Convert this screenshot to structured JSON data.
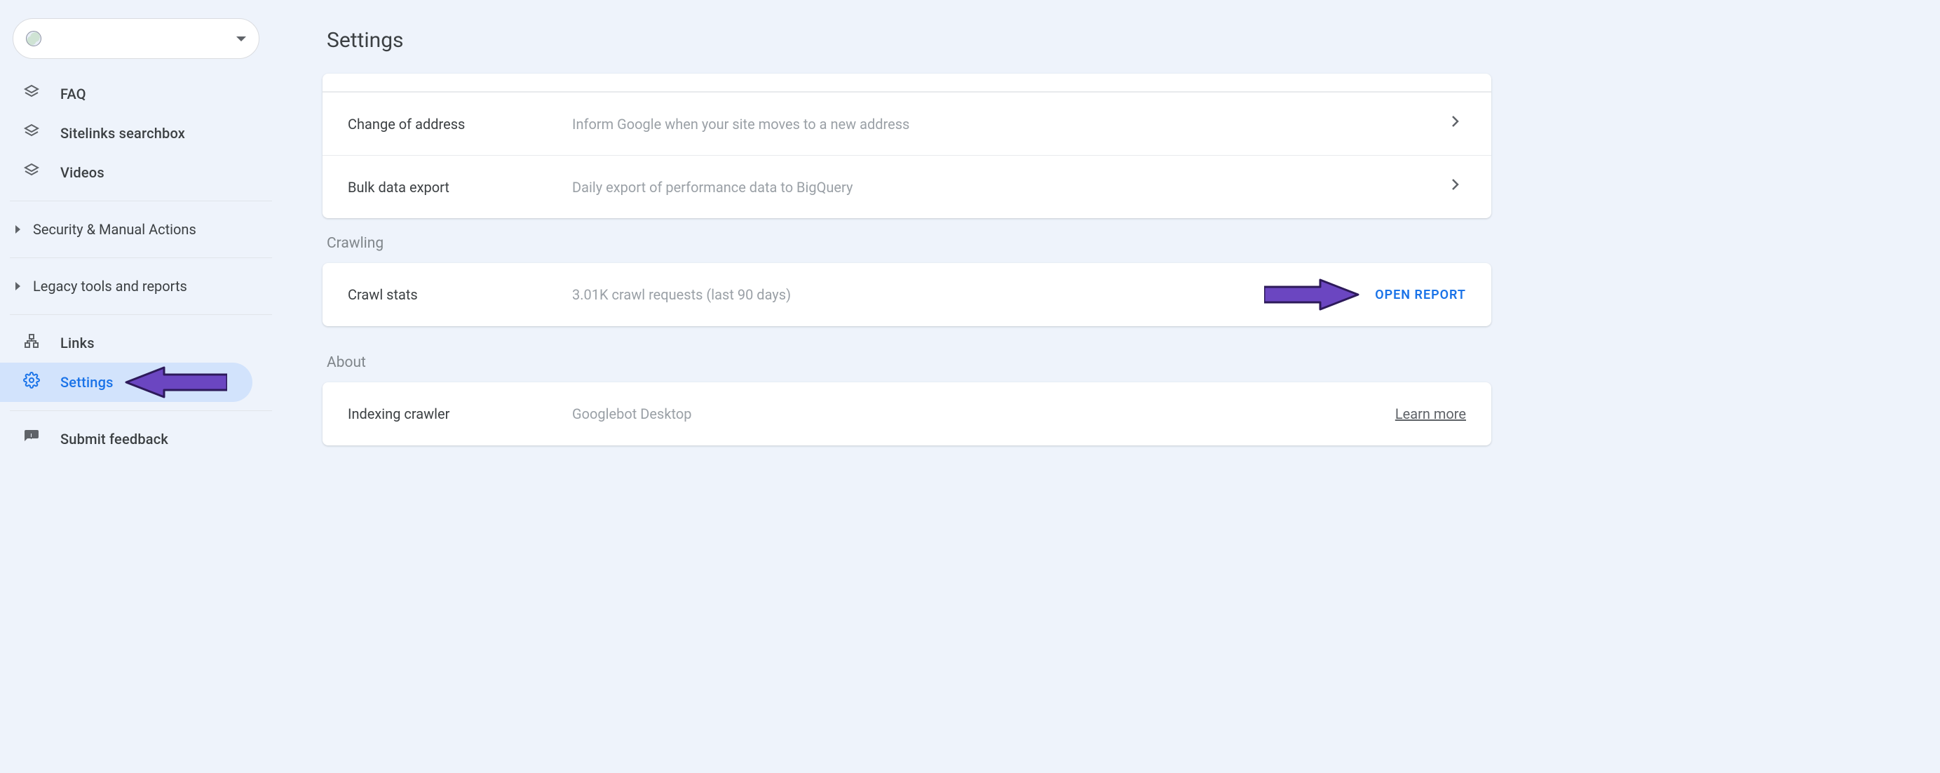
{
  "page": {
    "title": "Settings"
  },
  "property": {
    "value": ""
  },
  "sidebar": {
    "items": {
      "faq": {
        "label": "FAQ"
      },
      "sitelinks": {
        "label": "Sitelinks searchbox"
      },
      "videos": {
        "label": "Videos"
      },
      "security": {
        "label": "Security & Manual Actions"
      },
      "legacy": {
        "label": "Legacy tools and reports"
      },
      "links": {
        "label": "Links"
      },
      "settings": {
        "label": "Settings"
      },
      "feedback": {
        "label": "Submit feedback"
      }
    }
  },
  "sections": {
    "general": {
      "change_address": {
        "title": "Change of address",
        "desc": "Inform Google when your site moves to a new address"
      },
      "bulk_export": {
        "title": "Bulk data export",
        "desc": "Daily export of performance data to BigQuery"
      }
    },
    "crawling": {
      "heading": "Crawling",
      "crawl_stats": {
        "title": "Crawl stats",
        "desc": "3.01K crawl requests (last 90 days)",
        "action": "OPEN REPORT"
      }
    },
    "about": {
      "heading": "About",
      "indexing_crawler": {
        "title": "Indexing crawler",
        "desc": "Googlebot Desktop",
        "action": "Learn more"
      }
    }
  }
}
